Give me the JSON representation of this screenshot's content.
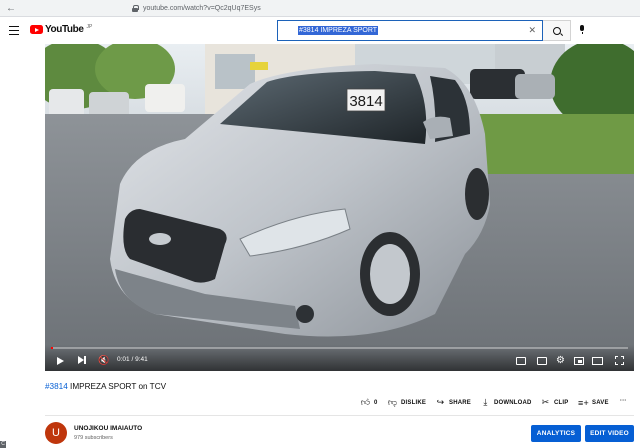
{
  "browser": {
    "url": "youtube.com/watch?v=Qc2qUq7ESys",
    "back_icon": "back-arrow-icon",
    "lock_icon": "lock-icon"
  },
  "header": {
    "menu_icon": "hamburger-icon",
    "logo_text": "YouTube",
    "logo_sup": "JP",
    "search_value": "#3814 IMPREZA SPORT",
    "search_clear": "✕",
    "search_icon": "search-icon",
    "mic_icon": "mic-icon"
  },
  "player": {
    "time": "0:01 / 9:41",
    "progress_fraction": 0.0017,
    "plate_number": "3814"
  },
  "video": {
    "title_hashtag": "#3814",
    "title_rest": " IMPREZA SPORT on TCV"
  },
  "actions": {
    "like_count": "0",
    "dislike": "DISLIKE",
    "share": "SHARE",
    "download": "DOWNLOAD",
    "clip": "CLIP",
    "save": "SAVE",
    "more": "···"
  },
  "channel": {
    "avatar_letter": "U",
    "name": "UNOJIKOU IMAIAUTO",
    "subscribers": "979 subscribers",
    "analytics_label": "ANALYTICS",
    "edit_label": "EDIT VIDEO"
  },
  "side": {
    "badge": "C"
  },
  "colors": {
    "accent": "#065fd4",
    "brand_red": "#ff0000",
    "avatar_bg": "#bf360c"
  }
}
